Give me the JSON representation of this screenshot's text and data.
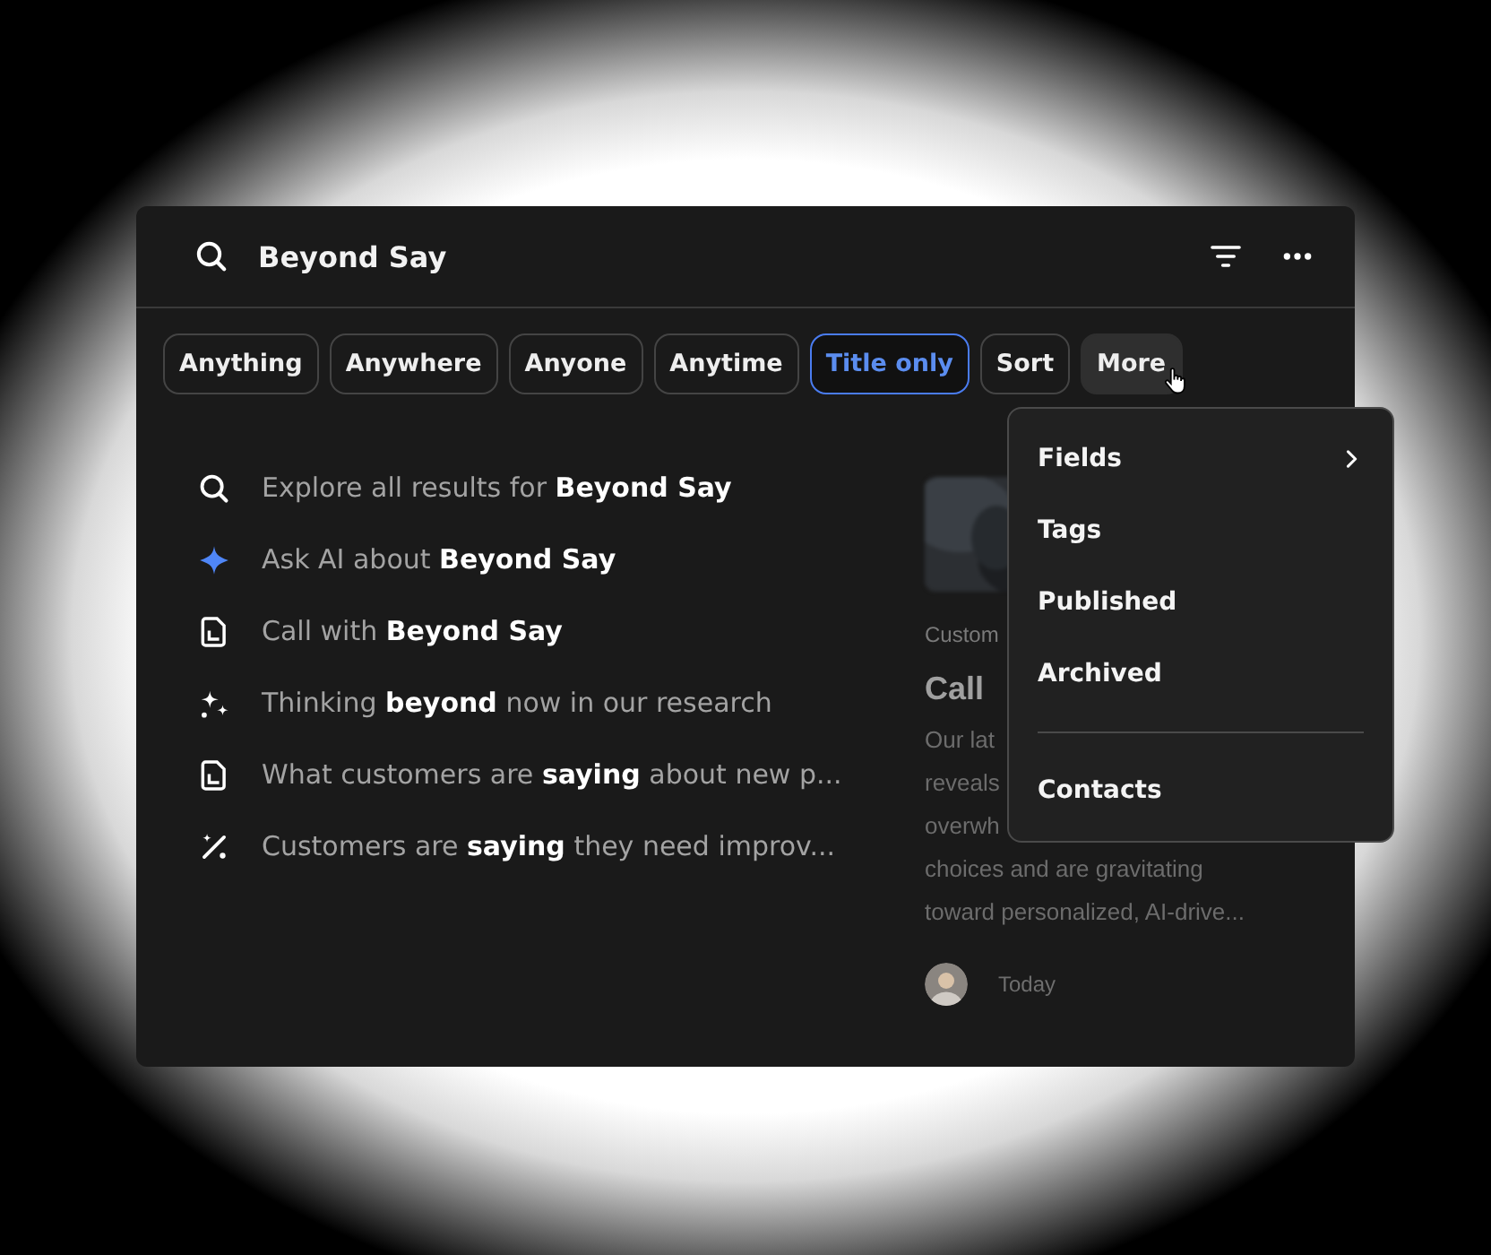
{
  "search": {
    "value": "Beyond Say"
  },
  "filters": [
    {
      "label": "Anything",
      "selected": false,
      "hovered": false
    },
    {
      "label": "Anywhere",
      "selected": false,
      "hovered": false
    },
    {
      "label": "Anyone",
      "selected": false,
      "hovered": false
    },
    {
      "label": "Anytime",
      "selected": false,
      "hovered": false
    },
    {
      "label": "Title only",
      "selected": true,
      "hovered": false
    },
    {
      "label": "Sort",
      "selected": false,
      "hovered": false
    },
    {
      "label": "More",
      "selected": false,
      "hovered": true
    }
  ],
  "suggestions": [
    {
      "kind": "search",
      "text": "Explore all results for **Beyond Say**"
    },
    {
      "kind": "ai",
      "text": "Ask AI about **Beyond Say**"
    },
    {
      "kind": "document",
      "text": "Call with **Beyond Say**"
    },
    {
      "kind": "sparkles",
      "text": "Thinking **beyond** now in our research"
    },
    {
      "kind": "document",
      "text": "What customers are **saying** about new p..."
    },
    {
      "kind": "wand",
      "text": "Customers are **saying** they need improv..."
    }
  ],
  "preview": {
    "category": "Custom",
    "title": "Call",
    "lines": [
      "Our lat",
      "reveals",
      "overwh",
      "choices and are gravitating",
      "toward personalized, AI-drive..."
    ],
    "date": "Today"
  },
  "menu": {
    "items": [
      {
        "label": "Fields",
        "submenu": true,
        "separator_before": false
      },
      {
        "label": "Tags",
        "submenu": false,
        "separator_before": false
      },
      {
        "label": "Published",
        "submenu": false,
        "separator_before": false
      },
      {
        "label": "Archived",
        "submenu": false,
        "separator_before": false
      },
      {
        "label": "Contacts",
        "submenu": false,
        "separator_before": true
      }
    ]
  }
}
